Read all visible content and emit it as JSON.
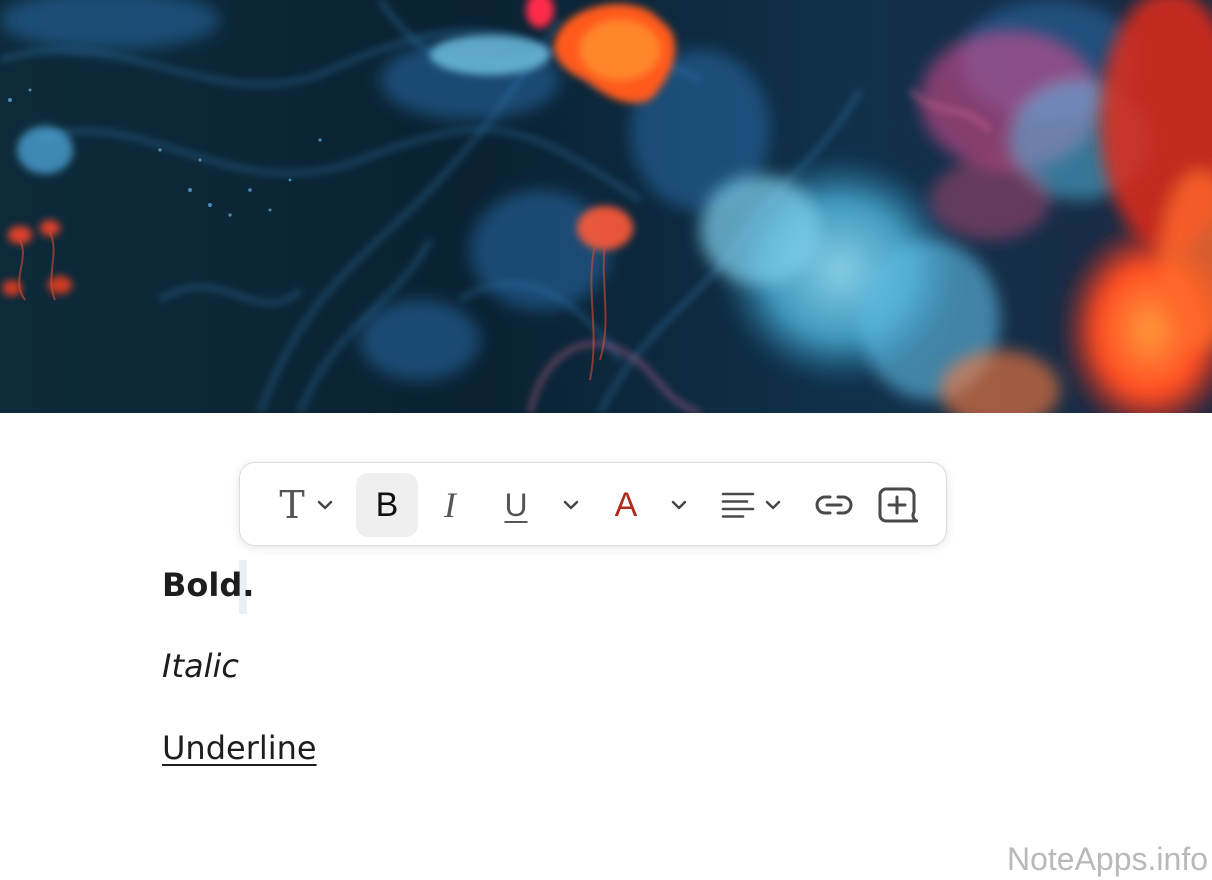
{
  "cover": {
    "description_icon": "abstract-ink-cover-image"
  },
  "toolbar": {
    "buttons": [
      {
        "name": "text-style-button",
        "glyph": "T",
        "has_dropdown": true
      },
      {
        "name": "bold-button",
        "glyph": "B",
        "active": true
      },
      {
        "name": "italic-button",
        "glyph": "I"
      },
      {
        "name": "underline-button",
        "glyph": "U",
        "has_dropdown": true
      },
      {
        "name": "text-color-button",
        "glyph": "A",
        "has_dropdown": true
      },
      {
        "name": "align-button",
        "icon": "align-left-icon",
        "has_dropdown": true
      },
      {
        "name": "link-button",
        "icon": "link-icon"
      },
      {
        "name": "insert-comment-button",
        "icon": "add-comment-icon"
      }
    ],
    "colors": {
      "text_color_accent": "#b02a1e",
      "active_background": "#efefef"
    }
  },
  "document": {
    "lines": [
      {
        "text": "Bold."
      },
      {
        "text": "Italic"
      },
      {
        "text": "Underline"
      }
    ]
  },
  "watermark": {
    "text": "NoteApps.info"
  }
}
